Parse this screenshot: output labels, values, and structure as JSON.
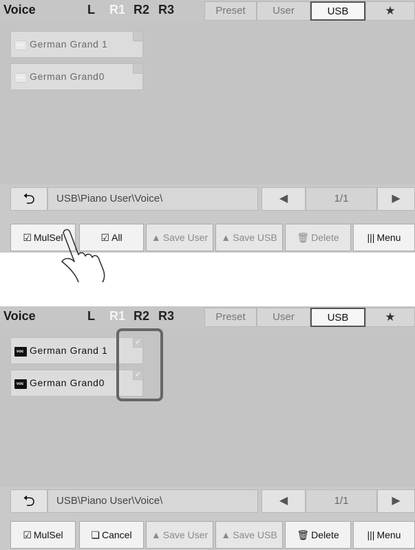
{
  "panels": [
    {
      "title": "Voice",
      "parts": [
        "L",
        "R1",
        "R2",
        "R3"
      ],
      "active_part": "R1",
      "tabs": {
        "preset": "Preset",
        "user": "User",
        "usb": "USB",
        "favorite": "★"
      },
      "voices": [
        {
          "icon_text": "voc",
          "name": "German Grand 1",
          "checked": false
        },
        {
          "icon_text": "voc",
          "name": "German Grand0",
          "checked": false
        }
      ],
      "path": "USB\\Piano User\\Voice\\",
      "page": "1/1",
      "buttons": {
        "multi_select": "MulSel",
        "second": "All",
        "save_user": "Save User",
        "save_usb": "Save USB",
        "delete": "Delete",
        "menu": "Menu"
      }
    },
    {
      "title": "Voice",
      "parts": [
        "L",
        "R1",
        "R2",
        "R3"
      ],
      "active_part": "R1",
      "tabs": {
        "preset": "Preset",
        "user": "User",
        "usb": "USB",
        "favorite": "★"
      },
      "voices": [
        {
          "icon_text": "voc",
          "name": "German Grand 1",
          "checked": true
        },
        {
          "icon_text": "voc",
          "name": "German Grand0",
          "checked": true
        }
      ],
      "path": "USB\\Piano User\\Voice\\",
      "page": "1/1",
      "buttons": {
        "multi_select": "MulSel",
        "second": "Cancel",
        "save_user": "Save User",
        "save_usb": "Save USB",
        "delete": "Delete",
        "menu": "Menu"
      }
    }
  ],
  "icons": {
    "back": "back-arrow-icon",
    "prev": "triangle-left-icon",
    "next": "triangle-right-icon",
    "check": "checkmark-icon",
    "multi_select": "checkbox-icon",
    "delete": "trash-icon",
    "menu": "bars-icon"
  },
  "colors": {
    "panel_bg": "#c4c4c4",
    "active_part": "#f4f4f4",
    "selected_tab": "#f6f6f6"
  }
}
